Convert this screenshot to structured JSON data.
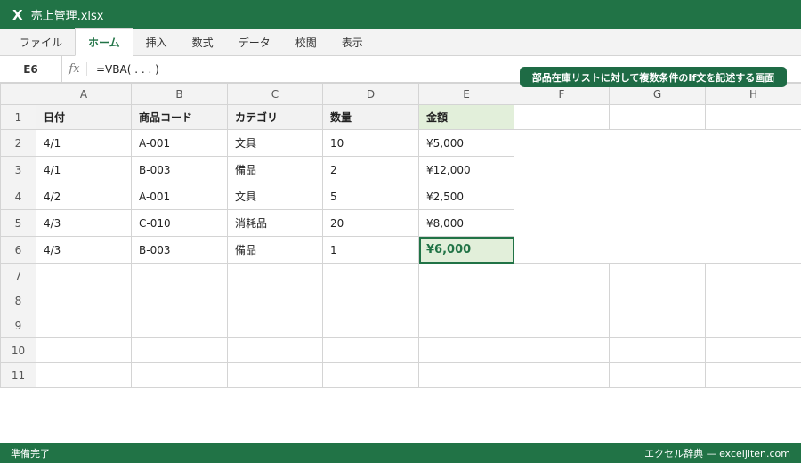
{
  "window": {
    "app_icon": "X",
    "title": "売上管理.xlsx"
  },
  "ribbon": {
    "tabs": [
      {
        "label": "ファイル"
      },
      {
        "label": "ホーム"
      },
      {
        "label": "挿入"
      },
      {
        "label": "数式"
      },
      {
        "label": "データ"
      },
      {
        "label": "校閲"
      },
      {
        "label": "表示"
      }
    ],
    "active_tab": "ホーム"
  },
  "formula_bar": {
    "name_box": "E6",
    "fx_label": "fx",
    "formula": "=VBA( . . . )"
  },
  "callout": "部品在庫リストに対して複数条件のIf文を記述する画面",
  "sheet": {
    "columns": [
      "A",
      "B",
      "C",
      "D",
      "E",
      "F",
      "G",
      "H"
    ],
    "rows": [
      "1",
      "2",
      "3",
      "4",
      "5",
      "6",
      "7",
      "8",
      "9",
      "10",
      "11"
    ],
    "headers": [
      "日付",
      "商品コード",
      "カテゴリ",
      "数量",
      "金額"
    ],
    "data": [
      [
        "4/1",
        "A-001",
        "文具",
        "10",
        "¥5,000"
      ],
      [
        "4/1",
        "B-003",
        "備品",
        "2",
        "¥12,000"
      ],
      [
        "4/2",
        "A-001",
        "文具",
        "5",
        "¥2,500"
      ],
      [
        "4/3",
        "C-010",
        "消耗品",
        "20",
        "¥8,000"
      ],
      [
        "4/3",
        "B-003",
        "備品",
        "1",
        "¥6,000"
      ]
    ],
    "selected_cell": "E6"
  },
  "status": {
    "left": "準備完了",
    "right": "エクセル辞典 — exceljiten.com"
  },
  "colors": {
    "accent": "#217346",
    "highlight": "#e2efda",
    "header_fill": "#f2f2f2"
  }
}
